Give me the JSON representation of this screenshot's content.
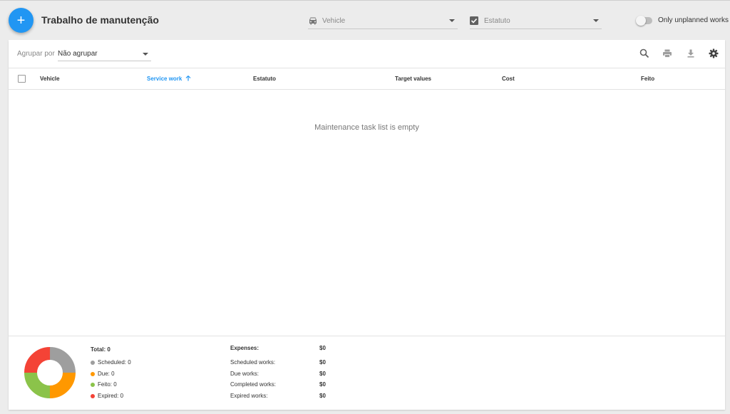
{
  "header": {
    "add_label": "+",
    "title": "Trabalho de manutenção",
    "vehicle_filter": "Vehicle",
    "status_filter": "Estatuto",
    "toggle_label": "Only unplanned works"
  },
  "toolbar": {
    "group_by_label": "Agrupar por",
    "group_by_value": "Não agrupar"
  },
  "table": {
    "columns": {
      "vehicle": "Vehicle",
      "service_work": "Service work",
      "status": "Estatuto",
      "target_values": "Target values",
      "cost": "Cost",
      "done": "Feito"
    },
    "empty_message": "Maintenance task list is empty"
  },
  "summary": {
    "total": "Total: 0",
    "legend": [
      {
        "label": "Scheduled: 0",
        "color": "#9e9e9e"
      },
      {
        "label": "Due: 0",
        "color": "#ff9800"
      },
      {
        "label": "Feito: 0",
        "color": "#8bc34a"
      },
      {
        "label": "Expired: 0",
        "color": "#f44336"
      }
    ],
    "expenses_label": "Expenses:",
    "expenses_value": "$0",
    "rows": [
      {
        "label": "Scheduled works:",
        "value": "$0"
      },
      {
        "label": "Due works:",
        "value": "$0"
      },
      {
        "label": "Completed works:",
        "value": "$0"
      },
      {
        "label": "Expired works:",
        "value": "$0"
      }
    ]
  },
  "colors": {
    "accent": "#2196f3",
    "scheduled": "#9e9e9e",
    "due": "#ff9800",
    "done": "#8bc34a",
    "expired": "#f44336"
  }
}
